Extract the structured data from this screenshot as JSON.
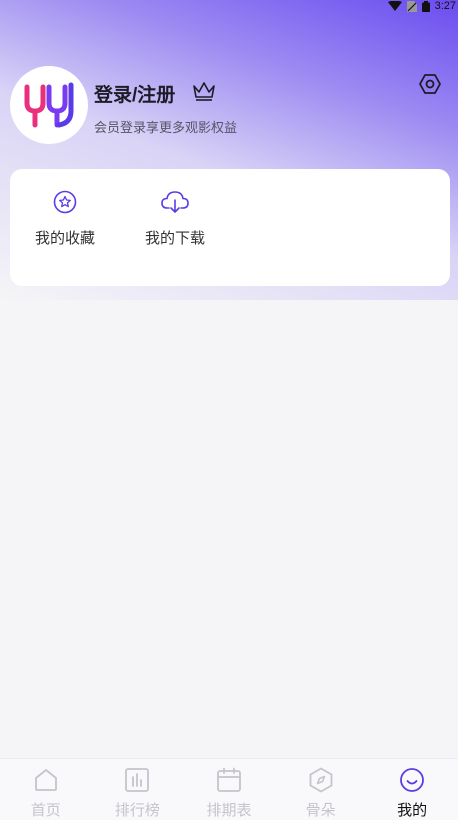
{
  "status_bar": {
    "time": "3:27"
  },
  "profile": {
    "title": "登录/注册",
    "subtitle": "会员登录享更多观影权益"
  },
  "quick_actions": [
    {
      "label": "我的收藏",
      "icon": "star-circle-icon"
    },
    {
      "label": "我的下载",
      "icon": "cloud-download-icon"
    }
  ],
  "tabs": [
    {
      "label": "首页",
      "icon": "home-icon",
      "active": false
    },
    {
      "label": "排行榜",
      "icon": "chart-icon",
      "active": false
    },
    {
      "label": "排期表",
      "icon": "calendar-icon",
      "active": false
    },
    {
      "label": "骨朵",
      "icon": "compass-icon",
      "active": false
    },
    {
      "label": "我的",
      "icon": "smile-icon",
      "active": true
    }
  ],
  "colors": {
    "accent": "#5b3be6",
    "tab_inactive": "#c4c4cc",
    "tab_active_label": "#111111",
    "logo_pink": "#e9307c",
    "logo_purple": "#7a3cf0"
  }
}
